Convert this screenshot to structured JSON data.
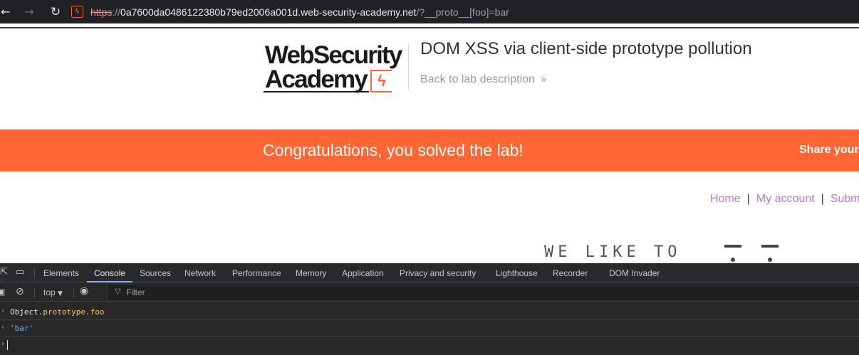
{
  "browser": {
    "back_icon": "arrow-left-icon",
    "forward_icon": "arrow-right-icon",
    "reload_icon": "reload-icon",
    "url_scheme": "https",
    "url_sep": "://",
    "url_host": "0a7600da0486122380b79ed2006a001d.web-security-academy.net",
    "url_path": "/?__proto__[foo]=bar"
  },
  "header": {
    "logo_line1": "WebSecurity",
    "logo_line2": "Academy",
    "lab_title": "DOM XSS via client-side prototype pollution",
    "back_link": "Back to lab description",
    "back_chevrons": "»"
  },
  "banner": {
    "message": "Congratulations, you solved the lab!",
    "share": "Share your",
    "color": "#ff6633"
  },
  "topnav": {
    "home": "Home",
    "sep1": "|",
    "my_account": "My account",
    "sep2": "|",
    "submit": "Subm"
  },
  "blog": {
    "heading": "WE LIKE TO"
  },
  "devtools": {
    "tabs": [
      "Elements",
      "Console",
      "Sources",
      "Network",
      "Performance",
      "Memory",
      "Application",
      "Privacy and security",
      "Lighthouse",
      "Recorder",
      "DOM Invader"
    ],
    "active_tab": "Console",
    "context": "top",
    "filter_placeholder": "Filter",
    "console": {
      "input_obj": "Object",
      "input_dot1": ".",
      "input_prop1": "prototype",
      "input_dot2": ".",
      "input_prop2": "foo",
      "output": "'bar'"
    }
  }
}
